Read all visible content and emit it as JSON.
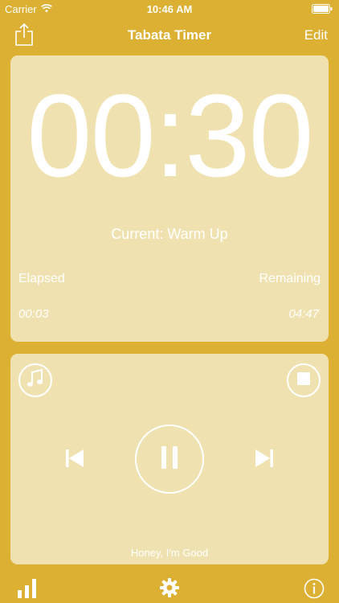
{
  "status_bar": {
    "carrier": "Carrier",
    "time": "10:46 AM"
  },
  "nav": {
    "title": "Tabata Timer",
    "edit_label": "Edit"
  },
  "timer": {
    "display": "00:30",
    "current": "Current: Warm Up",
    "elapsed_label": "Elapsed",
    "remaining_label": "Remaining",
    "elapsed_value": "00:03",
    "remaining_value": "04:47"
  },
  "player": {
    "song_title": "Honey, I'm Good"
  },
  "icons": {
    "share": "share-icon",
    "music": "music-note-icon",
    "stop": "stop-icon",
    "previous": "skip-previous-icon",
    "pause": "pause-icon",
    "next": "skip-next-icon",
    "stats": "bar-chart-icon",
    "settings": "gear-icon",
    "info": "info-icon"
  },
  "colors": {
    "background": "#dbb033",
    "card": "#f0e2b0",
    "foreground": "#ffffff"
  }
}
